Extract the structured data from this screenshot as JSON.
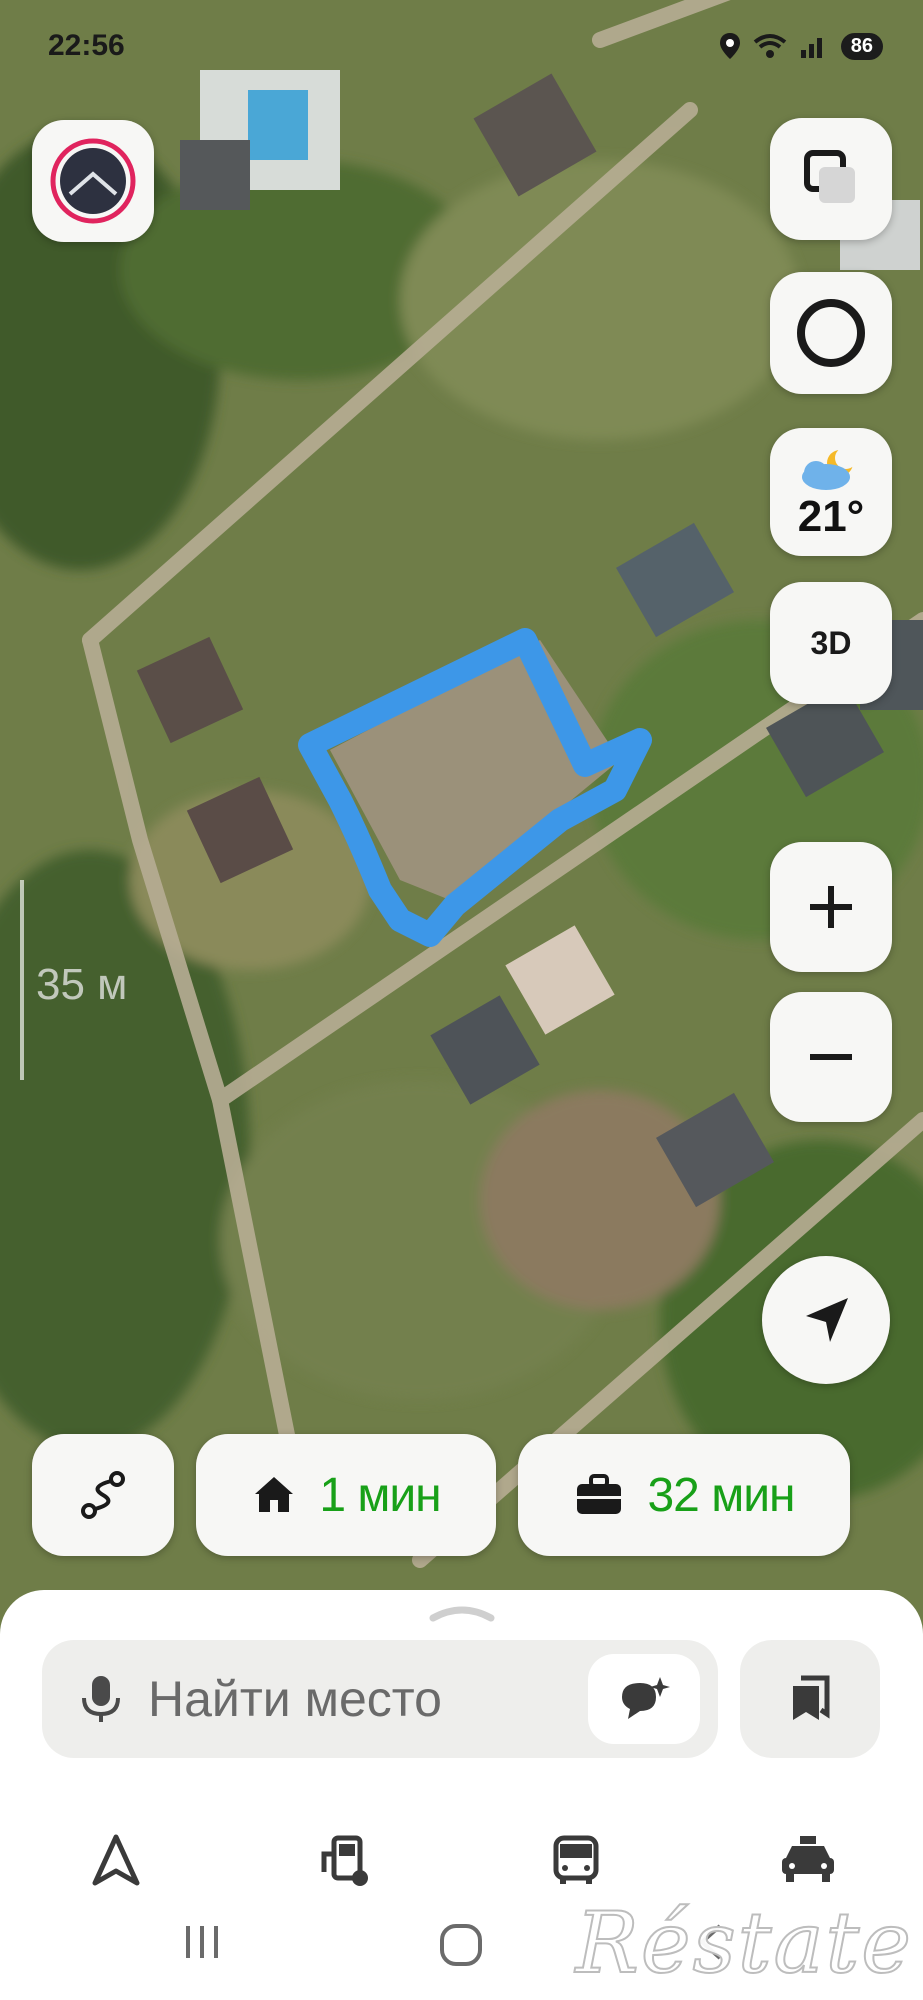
{
  "status_bar": {
    "time": "22:56",
    "battery": "86"
  },
  "map": {
    "scale_label": "35 м",
    "weather": {
      "temperature": "21°",
      "icon": "partly-cloudy-night-icon"
    },
    "view_3d_label": "3D",
    "highlight_color": "#3d97e8"
  },
  "shortcuts": [
    {
      "icon": "home-icon",
      "label": "1 мин"
    },
    {
      "icon": "briefcase-icon",
      "label": "32 мин"
    }
  ],
  "search": {
    "placeholder": "Найти место"
  },
  "bottom_tabs": [
    "navigator-icon",
    "fuel-station-icon",
    "bus-icon",
    "taxi-icon"
  ],
  "watermark": "Réstate",
  "colors": {
    "accent_green": "#18a018",
    "button_bg": "#f7f7f5"
  }
}
